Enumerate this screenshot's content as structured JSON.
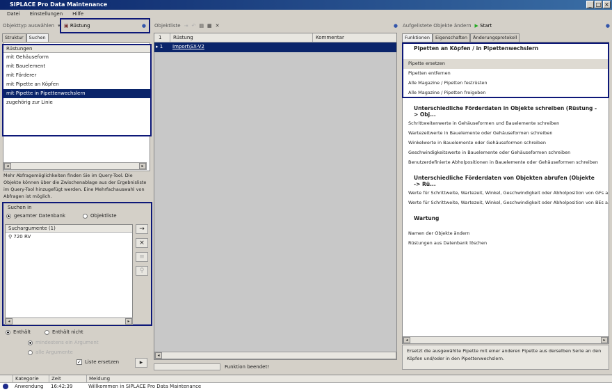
{
  "window": {
    "title": "SIPLACE Pro Data Maintenance"
  },
  "menu": [
    "Datei",
    "Einstellungen",
    "Hilfe"
  ],
  "left": {
    "objecttype_label": "Objekttyp auswählen",
    "objecttype_value": "Rüstung",
    "tabs": [
      "Struktur",
      "Suchen"
    ],
    "list_header": "Rüstungen",
    "list_items": [
      "mit Gehäuseform",
      "mit Bauelement",
      "mit Förderer",
      "mit Pipette an Köpfen",
      "mit Pipette in Pipettenwechslern",
      "zugehörig zur Linie"
    ],
    "selected_index": 4,
    "info": "Mehr Abfragemöglichkeiten finden Sie im Query-Tool. Die Objekte können über die Zwischenablage aus der Ergebnisliste im Query-Tool hinzugefügt werden. Eine Mehrfachauswahl von Abfragen ist möglich.",
    "search_in_label": "Suchen in",
    "search_db": "gesamter Datenbank",
    "search_list": "Objektliste",
    "args_header": "Suchargumente (1)",
    "args": [
      "720 RV"
    ],
    "contains": "Enthält",
    "not_contains": "Enthält nicht",
    "at_least_one": "mindestens ein Argument",
    "all_args": "alle Argumente",
    "replace_list": "Liste ersetzen"
  },
  "middle": {
    "title": "Objektliste",
    "columns": [
      "1",
      "Rüstung",
      "Kommentar"
    ],
    "rows": [
      {
        "num": "1",
        "name": "Import\\SX-V2",
        "comment": ""
      }
    ],
    "status": "Funktion beendet!"
  },
  "right": {
    "title": "Aufgelistete Objekte ändern",
    "start": "Start",
    "tabs": [
      "Funktionen",
      "Eigenschaften",
      "Änderungsprotokoll"
    ],
    "sections": [
      {
        "title": "Pipetten an Köpfen / in Pipettenwechslern",
        "items": [
          "Pipette ersetzen",
          "Pipetten entfernen",
          "Alle Magazine / Pipetten festrüsten",
          "Alle Magazine / Pipetten freigeben"
        ]
      },
      {
        "title": "Unterschiedliche Förderdaten in Objekte schreiben (Rüstung -> Obj...",
        "items": [
          "Schrittweitenwerte in Gehäuseformen und Bauelemente schreiben",
          "Wartezeitwerte in Bauelemente oder Gehäuseformen schreiben",
          "Winkelwerte in Bauelemente oder Gehäuseformen schreiben",
          "Geschwindigkeitswerte in Bauelemente oder Gehäuseformen schreiben",
          "Benutzerdefinierte Abholpositionen in Bauelemente oder Gehäuseformen schreiben"
        ]
      },
      {
        "title": "Unterschiedliche Förderdaten von Objekten abrufen (Objekte -> Rü...",
        "items": [
          "Werte für Schrittweite, Wartezeit, Winkel, Geschwindigkeit oder Abholposition von GFs a...",
          "Werte für Schrittweite, Wartezeit, Winkel, Geschwindigkeit oder Abholposition von BEs a..."
        ]
      },
      {
        "title": "Wartung",
        "items": [
          "Namen der Objekte ändern",
          "Rüstungen aus Datenbank löschen"
        ]
      }
    ],
    "description": "Ersetzt die ausgewählte Pipette mit einer anderen Pipette aus derselben Serie an den Köpfen und/oder in den Pipettenwechslern."
  },
  "log": {
    "columns": [
      "Kategorie",
      "Zeit",
      "Meldung"
    ],
    "rows": [
      {
        "category": "Anwendung",
        "time": "16:42:39",
        "message": "Willkommen in SIPLACE Pro Data Maintenance"
      }
    ]
  }
}
